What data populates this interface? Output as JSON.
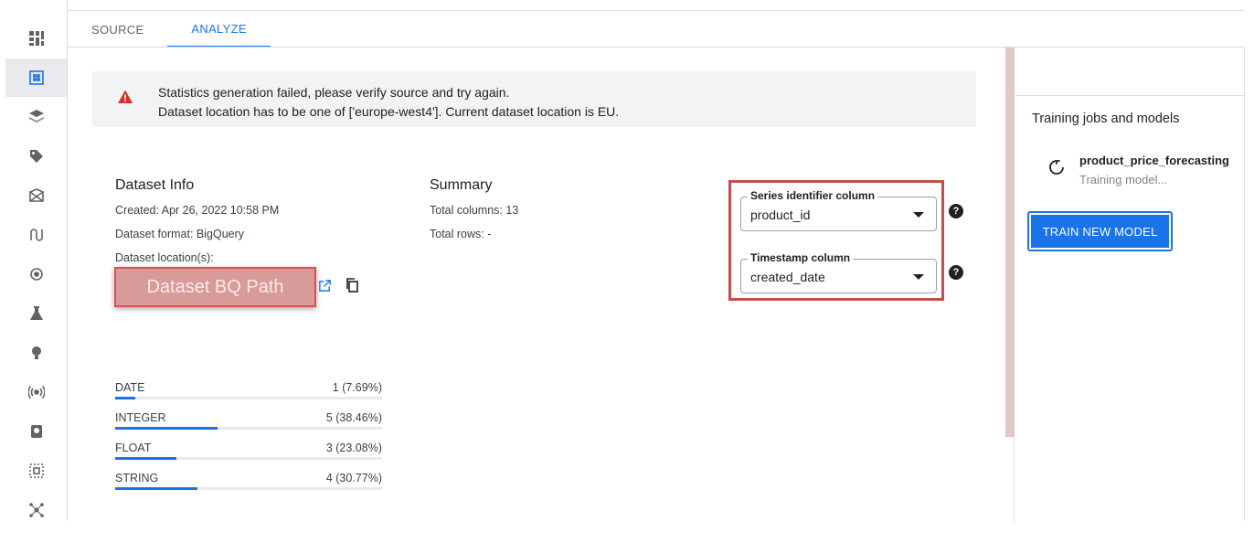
{
  "tabs": [
    {
      "label": "SOURCE"
    },
    {
      "label": "ANALYZE"
    }
  ],
  "rail": {
    "items": [
      "dashboard-icon",
      "datasets-icon",
      "features-icon",
      "labeling-icon",
      "workbench-icon",
      "pipelines-icon",
      "training-icon",
      "experiments-icon",
      "models-icon",
      "endpoints-icon",
      "batch-icon",
      "metadata-icon",
      "matching-icon"
    ]
  },
  "banner": {
    "line1": "Statistics generation failed, please verify source and try again.",
    "line2": "Dataset location has to be one of ['europe-west4']. Current dataset location is EU."
  },
  "dataset_info": {
    "title": "Dataset Info",
    "created": "Created: Apr 26, 2022 10:58 PM",
    "format": "Dataset format: BigQuery",
    "location": "Dataset location(s):",
    "bq_path": "Dataset BQ Path"
  },
  "summary": {
    "title": "Summary",
    "total_columns": "Total columns: 13",
    "total_rows": "Total rows: -"
  },
  "column_types": [
    {
      "label": "DATE",
      "value": "1 (7.69%)",
      "fraction": 0.0769
    },
    {
      "label": "INTEGER",
      "value": "5 (38.46%)",
      "fraction": 0.3846
    },
    {
      "label": "FLOAT",
      "value": "3 (23.08%)",
      "fraction": 0.2308
    },
    {
      "label": "STRING",
      "value": "4 (30.77%)",
      "fraction": 0.3077
    }
  ],
  "selects": {
    "series": {
      "label": "Series identifier column",
      "value": "product_id"
    },
    "timestamp": {
      "label": "Timestamp column",
      "value": "created_date"
    }
  },
  "right_panel": {
    "title": "Training jobs and models",
    "job_name": "product_price_forecasting",
    "job_status": "Training model...",
    "train_button": "TRAIN NEW MODEL"
  },
  "colors": {
    "accent": "#1a73e8",
    "warning": "#d93025",
    "highlight_border": "#c0504d"
  }
}
